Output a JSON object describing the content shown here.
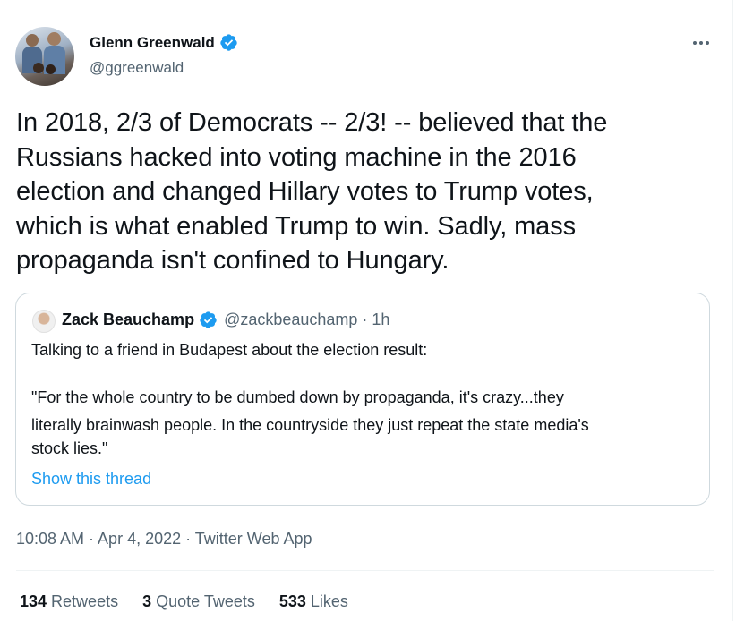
{
  "tweet": {
    "author_name": "Glenn Greenwald",
    "handle": "@ggreenwald",
    "lines": [
      "In 2018, 2/3 of Democrats -- 2/3! -- believed that the",
      "Russians hacked into voting machine in the 2016",
      "election and changed Hillary votes to Trump votes,",
      "which is what enabled Trump to win. Sadly, mass",
      "propaganda isn't confined to Hungary."
    ],
    "timestamp": "10:08 AM · Apr 4, 2022 · Twitter Web App",
    "more_icon": "ellipsis-icon"
  },
  "quote": {
    "author_name": "Zack Beauchamp",
    "meta": "@zackbeauchamp · 1h",
    "lines": [
      "Talking to a friend in Budapest about the election result:",
      "\"For the whole country to be dumbed down by propaganda, it's crazy...they",
      "literally brainwash people. In the countryside they just repeat the state media's",
      "stock lies.\""
    ],
    "show_thread": "Show this thread"
  },
  "stats": {
    "retweets_count": "134",
    "retweets_label": "Retweets",
    "quotes_count": "3",
    "quotes_label": "Quote Tweets",
    "likes_count": "533",
    "likes_label": "Likes"
  },
  "colors": {
    "verified": "#1d9bf0",
    "link": "#1d9bf0",
    "secondary_text": "#536471",
    "border": "#cfd9de"
  }
}
